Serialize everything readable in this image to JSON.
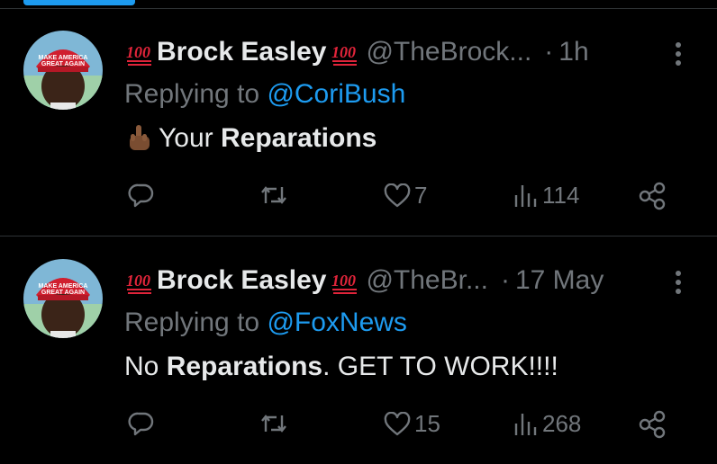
{
  "tweets": [
    {
      "display_name": "Brock Easley",
      "emoji": "💯",
      "handle": "@TheBrock...",
      "dot": "·",
      "time": "1h",
      "replying_prefix": "Replying to",
      "replying_to": "@CoriBush",
      "text_icon": "middle-finger-emoji",
      "text_plain_1": "Your",
      "text_bold_1": "Reparations",
      "text_plain_2": "",
      "stats": {
        "replies": "",
        "retweets": "",
        "likes": "7",
        "views": "114"
      }
    },
    {
      "display_name": "Brock Easley",
      "emoji": "💯",
      "handle": "@TheBr...",
      "dot": "·",
      "time": "17 May",
      "replying_prefix": "Replying to",
      "replying_to": "@FoxNews",
      "text_icon": "",
      "text_plain_1": "No",
      "text_bold_1": "Reparations",
      "text_plain_2": ". GET TO WORK!!!!",
      "stats": {
        "replies": "",
        "retweets": "",
        "likes": "15",
        "views": "268"
      }
    }
  ],
  "colors": {
    "background": "#000000",
    "text": "#e7e9ea",
    "muted": "#71767b",
    "link": "#1d9bf0",
    "divider": "#2f3336"
  }
}
